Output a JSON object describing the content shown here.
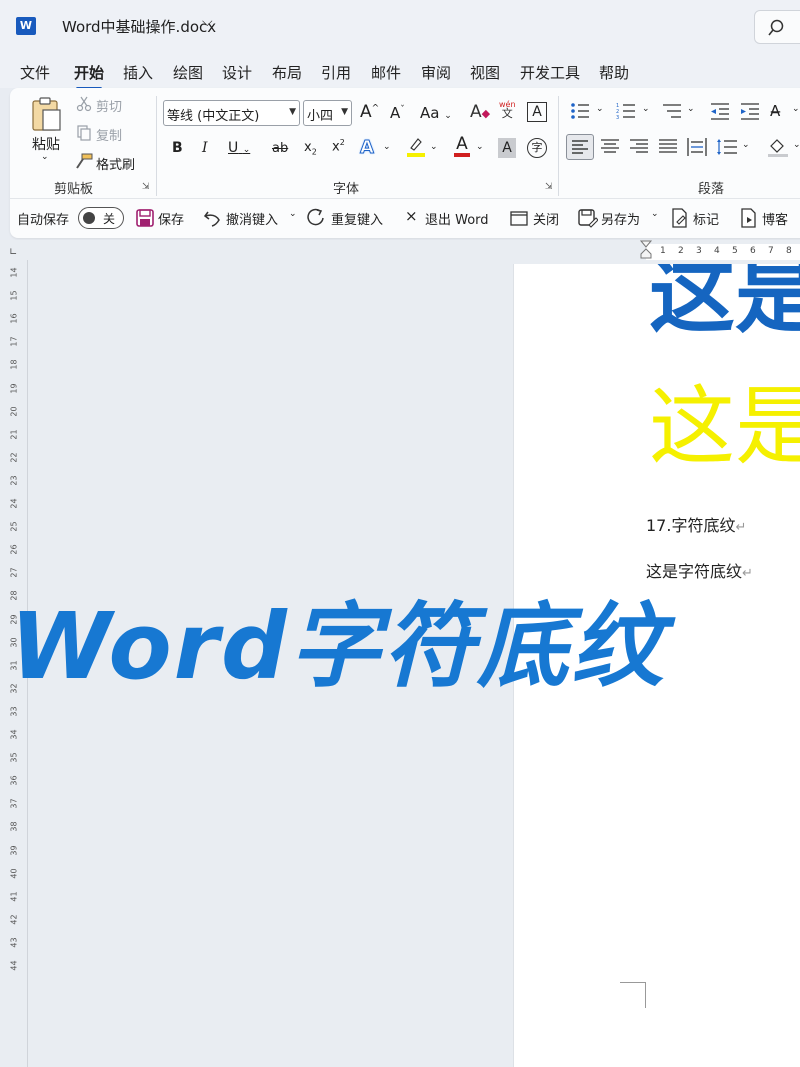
{
  "titlebar": {
    "app_icon": "word-icon",
    "app_icon_letter": "W",
    "doc_title": "Word中基础操作.docx"
  },
  "menu": {
    "tabs": [
      "文件",
      "开始",
      "插入",
      "绘图",
      "设计",
      "布局",
      "引用",
      "邮件",
      "审阅",
      "视图",
      "开发工具",
      "帮助"
    ],
    "active": "开始"
  },
  "clipboard": {
    "paste_label": "粘贴",
    "cut_label": "剪切",
    "copy_label": "复制",
    "format_painter_label": "格式刷",
    "group_label": "剪贴板"
  },
  "font": {
    "font_name": "等线 (中文正文)",
    "font_size": "小四",
    "grow_label": "A",
    "shrink_label": "A",
    "case_label": "Aa",
    "phonetic_label": "wén",
    "phonetic_sub": "文",
    "border_label": "A",
    "bold_label": "B",
    "italic_label": "I",
    "underline_label": "U",
    "strike_label": "ab",
    "subscript_label": "x",
    "superscript_label": "x",
    "effects_label": "A",
    "highlight_color": "#f5f000",
    "font_color_label": "A",
    "font_color": "#d01f1f",
    "shading_label": "A",
    "enclose_label": "字",
    "group_label": "字体"
  },
  "paragraph": {
    "group_label": "段落"
  },
  "quick_access": {
    "autosave_label": "自动保存",
    "autosave_state": "关",
    "save_label": "保存",
    "undo_label": "撤消键入",
    "redo_label": "重复键入",
    "exit_label": "退出 Word",
    "close_label": "关闭",
    "save_as_label": "另存为",
    "mark_label": "标记",
    "blog_label": "博客"
  },
  "ruler": {
    "horizontal": [
      "1",
      "2",
      "3",
      "4",
      "5",
      "6",
      "7",
      "8"
    ],
    "vertical": [
      "14",
      "15",
      "16",
      "17",
      "18",
      "19",
      "20",
      "21",
      "22",
      "23",
      "24",
      "25",
      "26",
      "27",
      "28",
      "29",
      "30",
      "31",
      "32",
      "33",
      "34",
      "35",
      "36",
      "37",
      "38",
      "39",
      "40",
      "41",
      "42",
      "43",
      "44"
    ]
  },
  "document": {
    "big_blue_text": "这是",
    "big_yellow_text": "这是",
    "heading_line": "17.字符底纹",
    "body_line": "这是字符底纹",
    "para_mark": "↵",
    "blue_color": "#1565c0",
    "yellow_color": "#f5f000"
  },
  "overlay": {
    "headline": "Word字符底纹",
    "color": "#1778d2"
  }
}
